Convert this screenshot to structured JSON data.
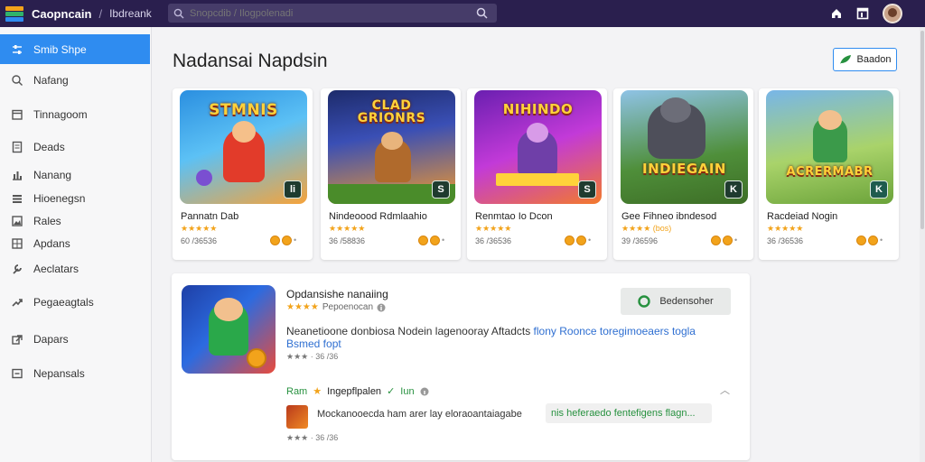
{
  "app": {
    "brand": "Caopncain",
    "crumb_sep": "/",
    "crumb": "Ibdreank",
    "search_placeholder": "Snopcdib / Ilogpolenadi"
  },
  "colors": {
    "topbar": "#2a1f4e",
    "accent": "#2f8cf0",
    "star": "#f2a31b",
    "green": "#27913f"
  },
  "sidebar": {
    "items": [
      {
        "label": "Smib Shpe",
        "icon": "sliders-icon",
        "active": true
      },
      {
        "label": "Nafang",
        "icon": "search-icon",
        "active": false
      },
      {
        "label": "Tinnagoom",
        "icon": "calendar-icon",
        "active": false
      },
      {
        "label": "Deads",
        "icon": "document-icon",
        "active": false
      },
      {
        "label": "Nanang",
        "icon": "chart-icon",
        "active": false
      },
      {
        "label": "Hioenegsn",
        "icon": "list-icon",
        "active": false
      },
      {
        "label": "Rales",
        "icon": "image-icon",
        "active": false
      },
      {
        "label": "Apdans",
        "icon": "grid-icon",
        "active": false
      },
      {
        "label": "Aeclatars",
        "icon": "wrench-icon",
        "active": false
      },
      {
        "label": "Pegaeagtals",
        "icon": "trend-icon",
        "active": false
      },
      {
        "label": "Dapars",
        "icon": "export-icon",
        "active": false
      },
      {
        "label": "Nepansals",
        "icon": "panel-icon",
        "active": false
      }
    ]
  },
  "main": {
    "title": "Nadansai Napdsin",
    "top_button": "Baadon",
    "cards": [
      {
        "art_title": "STMNIS",
        "badge": "li",
        "name": "Pannatn Dab",
        "stars": "★★★★★",
        "meta": "60 /36536"
      },
      {
        "art_title": "CLAD GRIONRS",
        "badge": "S",
        "name": "Nindeoood Rdmlaahio",
        "stars": "★★★★★",
        "meta": "36 /58836"
      },
      {
        "art_title": "NIHINDO",
        "badge": "S",
        "name": "Renmtao Io Dcon",
        "stars": "★★★★★",
        "meta": "36 /36536"
      },
      {
        "art_title": "INDIEGAIN",
        "badge": "K",
        "name": "Gee Fihneo ibndesod",
        "stars": "★★★★ (bos)",
        "meta": "39 /36596"
      },
      {
        "art_title": "ACRERMABR",
        "badge": "K",
        "name": "Racdeiad Nogin",
        "stars": "★★★★★",
        "meta": "36 /36536"
      }
    ],
    "detail": {
      "title": "Opdansishe nanaiing",
      "rating_stars": "★★★★",
      "rating_text": "Pepoenocan",
      "button": "Bedensoher",
      "description_plain": "Neanetioone donbiosa Nodein lagenooray Aftadcts",
      "description_link": "flony Roonce toregimoeaers togla Bsmed fopt",
      "meta": "★★★ · 36 /36",
      "row_green": "Ram",
      "row_label": "Ingepflpalen",
      "row_green2": "Iun",
      "sub_text": "Mockanooecda ham arer lay eloraoantaiagabe",
      "chip_text": "nis heferaedo fentefigens flagn...",
      "meta2": "★★★ · 36 /36"
    }
  }
}
